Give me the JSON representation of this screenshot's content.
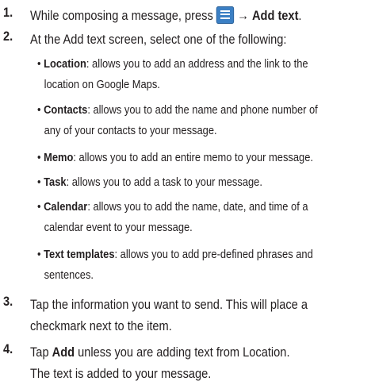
{
  "steps": [
    {
      "number": "1.",
      "text_before": "While composing a message, press ",
      "arrow": "→",
      "bold": "Add text",
      "after": "."
    },
    {
      "number": "2.",
      "text": "At the Add text screen, select one of the following:"
    },
    {
      "number": "3.",
      "lines": [
        "Tap the information you want to send. This will place a",
        "checkmark next to the item."
      ]
    },
    {
      "number": "4.",
      "line1_before": "Tap ",
      "line1_bold": "Add",
      "line1_after": " unless you are adding text from Location.",
      "line2": "The text is added to your message."
    }
  ],
  "options": [
    {
      "bullet": "•",
      "name": "Location",
      "lines": [
        ": allows you to add an address and the link to the",
        "location on Google Maps."
      ]
    },
    {
      "bullet": "•",
      "name": "Contacts",
      "lines": [
        ": allows you to add the name and phone number of",
        "any of your contacts to your message."
      ]
    },
    {
      "bullet": "•",
      "name": "Memo",
      "lines": [
        ": allows you to add an entire memo to your message."
      ]
    },
    {
      "bullet": "•",
      "name": "Task",
      "lines": [
        ": allows you to add a task to your message."
      ]
    },
    {
      "bullet": "•",
      "name": "Calendar",
      "lines": [
        ": allows you to add the name, date, and time of a",
        "calendar event to your message."
      ]
    },
    {
      "bullet": "•",
      "name": "Text templates",
      "lines": [
        ": allows you to add pre-defined phrases and",
        "sentences."
      ]
    }
  ],
  "icons": {
    "menu_key": "menu-key-icon"
  },
  "colors": {
    "icon_blue": "#3b7fc4",
    "text": "#231f20"
  }
}
